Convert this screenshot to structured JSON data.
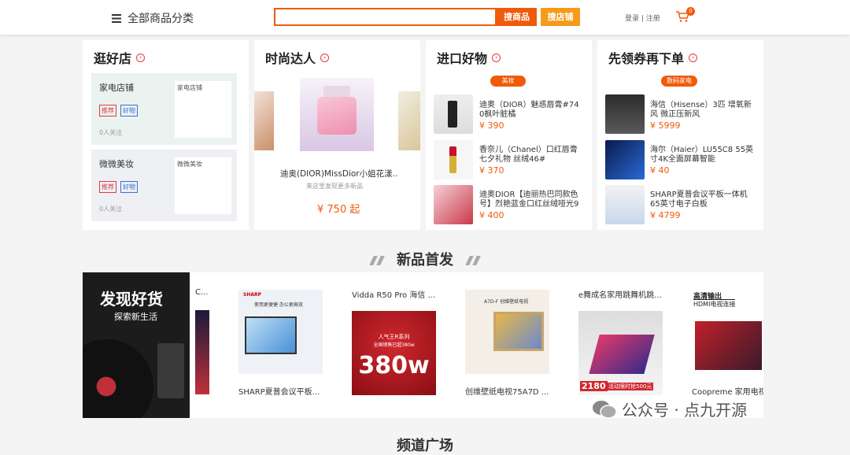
{
  "header": {
    "category_label": "全部商品分类",
    "search_placeholder": "",
    "search_button": "搜商品",
    "shop_button": "搜店铺",
    "login_text": "登录 | 注册",
    "cart_count": "0"
  },
  "panels": {
    "shops": {
      "title": "逛好店",
      "items": [
        {
          "name": "家电店铺",
          "tag1": "推荐",
          "tag2": "好物",
          "followers": "0人关注",
          "img_alt": "家电店铺"
        },
        {
          "name": "微微美妆",
          "tag1": "推荐",
          "tag2": "好物",
          "followers": "0人关注",
          "img_alt": "微微美妆"
        }
      ]
    },
    "fashion": {
      "title": "时尚达人",
      "product": "迪奥(DIOR)MissDior小姐花漾...",
      "sub": "来这里发现更多新品",
      "price": "¥ 750 起"
    },
    "import": {
      "title": "进口好物",
      "pill": "美妆",
      "items": [
        {
          "title1": "迪奥（DIOR）魅惑唇膏#74",
          "title2": "0枫叶脏橘",
          "price": "¥ 390"
        },
        {
          "title1": "香奈儿（Chanel）口红唇膏",
          "title2": "七夕礼物 丝绒46#",
          "price": "¥ 370"
        },
        {
          "title1": "迪奥DIOR【迪丽热巴同款色",
          "title2": "号】烈艳蓝金口红丝绒哑光9",
          "price": "¥ 400"
        }
      ]
    },
    "coupon": {
      "title": "先领券再下单",
      "pill": "数码家电",
      "items": [
        {
          "title1": "海信（Hisense）3匹 增氧新",
          "title2": "风 微正压新风",
          "price": "¥ 5999"
        },
        {
          "title1": "海尔（Haier）LU55C8 55英",
          "title2": "寸4K全面屏幕智能",
          "price": "¥ 40"
        },
        {
          "title1": "SHARP夏普会议平板一体机",
          "title2": "65英寸电子白板",
          "price": "¥ 4799"
        }
      ]
    }
  },
  "new_section": {
    "title": "新品首发",
    "banner_line1": "发现好货",
    "banner_line2": "探索新生活",
    "cards": [
      {
        "top": "C...",
        "bottom": ""
      },
      {
        "top": "",
        "bottom": "SHARP夏普会议平板..."
      },
      {
        "top": "Vidda R50 Pro 海信 ...",
        "bottom": ""
      },
      {
        "top": "",
        "bottom": "创维壁纸电视75A7D ..."
      },
      {
        "top": "e舞成名家用跳舞机跳...",
        "bottom": ""
      },
      {
        "top": "",
        "bottom": "Coopreme 家用电视"
      }
    ],
    "img_texts": {
      "sharp": "SHARP",
      "sharp_sub": "使用更便捷 办公更高效",
      "vidda_series": "人气王R系列",
      "vidda_sub": "全国销售已超380w",
      "vidda_big": "380w",
      "skyworth": "A7D-F 创维壁纸电视",
      "dance_price": "2180",
      "dance_sub": "活动限时抢500元",
      "hdmi1": "高清输出",
      "hdmi2": "HDMI电视连接"
    }
  },
  "next_section": {
    "title": "频道广场"
  },
  "watermark": {
    "text": "公众号 · 点九开源"
  }
}
